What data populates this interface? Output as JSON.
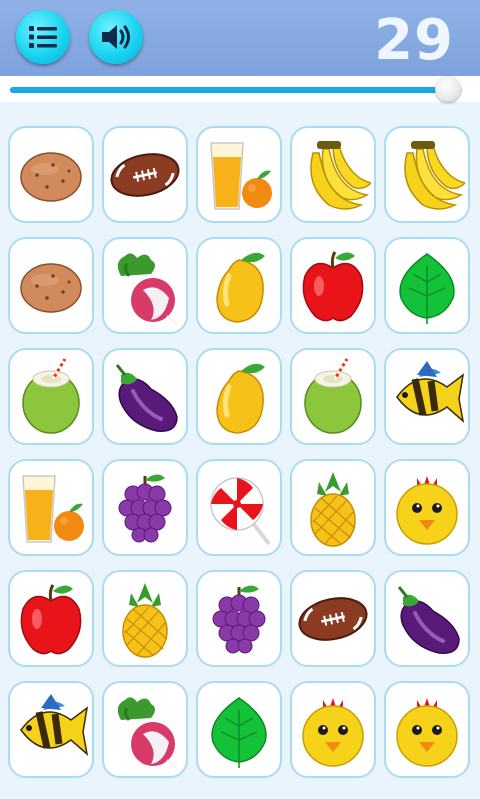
{
  "score": "29",
  "progress": 0.97,
  "colors": {
    "bar": "#8fb1e6",
    "button": "#1ad4f0",
    "card_border": "#a9dcf2"
  },
  "buttons": [
    {
      "name": "menu-button",
      "icon": "menu-list-icon"
    },
    {
      "name": "sound-button",
      "icon": "speaker-icon"
    }
  ],
  "board": [
    [
      "potato",
      "football",
      "juice",
      "banana",
      "banana"
    ],
    [
      "potato",
      "radish",
      "mango",
      "apple",
      "leaf"
    ],
    [
      "coconut",
      "eggplant",
      "mango",
      "coconut",
      "fish"
    ],
    [
      "juice",
      "grapes",
      "lollipop",
      "pineapple",
      "chick"
    ],
    [
      "apple",
      "pineapple",
      "grapes",
      "football",
      "eggplant"
    ],
    [
      "fish",
      "radish",
      "leaf",
      "chick",
      "chick"
    ]
  ]
}
